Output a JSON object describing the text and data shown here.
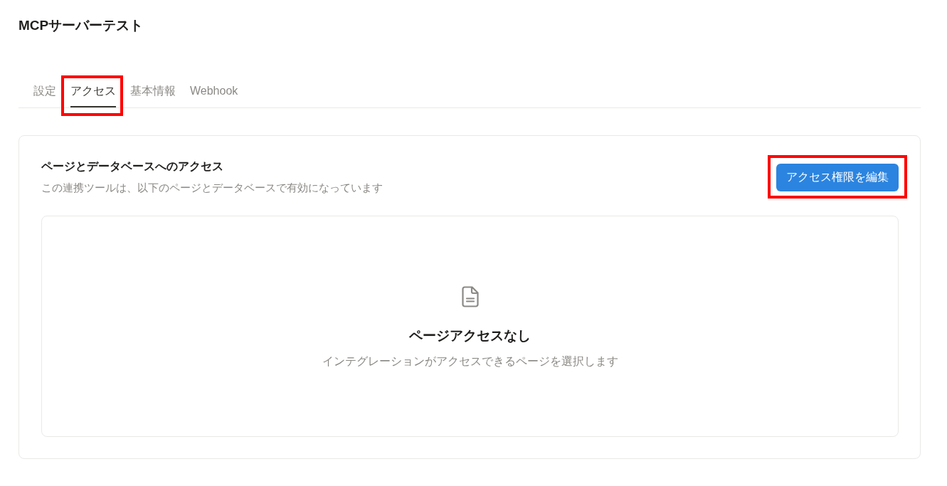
{
  "page": {
    "title": "MCPサーバーテスト"
  },
  "tabs": [
    {
      "label": "設定",
      "selected": false,
      "highlighted": false
    },
    {
      "label": "アクセス",
      "selected": true,
      "highlighted": true
    },
    {
      "label": "基本情報",
      "selected": false,
      "highlighted": false
    },
    {
      "label": "Webhook",
      "selected": false,
      "highlighted": false
    }
  ],
  "access_panel": {
    "heading": "ページとデータベースへのアクセス",
    "description": "この連携ツールは、以下のページとデータベースで有効になっています",
    "edit_button": {
      "label": "アクセス権限を編集",
      "highlighted": true
    },
    "empty_state": {
      "title": "ページアクセスなし",
      "message": "インテグレーションがアクセスできるページを選択します"
    }
  }
}
